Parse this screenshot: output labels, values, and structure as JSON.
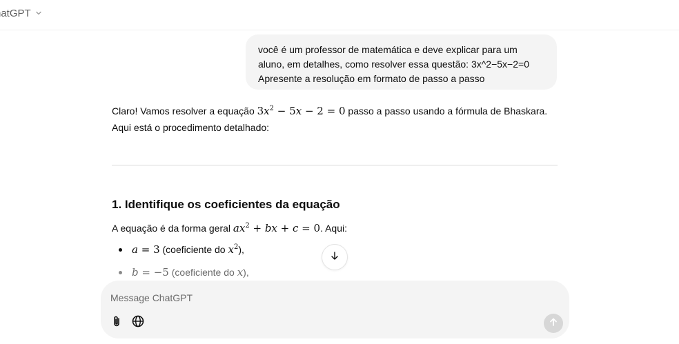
{
  "header": {
    "model_name": "hatGPT",
    "chevron_icon": "chevron-down-icon"
  },
  "user_message": {
    "lines": [
      "você é um professor de matemática e deve explicar para um",
      "aluno, em detalhes, como resolver essa questão: 3x^2−5x−2=0",
      "Apresente a resolução em formato de passo a passo"
    ]
  },
  "assistant": {
    "intro_prefix": "Claro! Vamos resolver a equação ",
    "intro_suffix": " passo a passo usando a fórmula de Bhaskara.",
    "intro_line2": "Aqui está o procedimento detalhado:",
    "section_title": "1. Identifique os coeficientes da equação",
    "section_text_prefix": "A equação é da forma geral ",
    "section_text_suffix": ". Aqui:",
    "bullets": [
      {
        "text": " (coeficiente do ",
        "tail": "),",
        "var": "x"
      },
      {
        "text": " (coeficiente do ",
        "tail": "),",
        "var": "x"
      }
    ]
  },
  "composer": {
    "placeholder": "Message ChatGPT",
    "attach_icon": "paperclip-icon",
    "search_icon": "globe-icon",
    "send_icon": "arrow-up-icon"
  },
  "scroll_button_icon": "arrow-down-icon",
  "colors": {
    "bubble_bg": "#f4f4f4",
    "composer_bg": "#f4f4f4",
    "send_disabled": "#d7d7d7",
    "text": "#0d0d0d",
    "muted": "#6b6b6b"
  }
}
